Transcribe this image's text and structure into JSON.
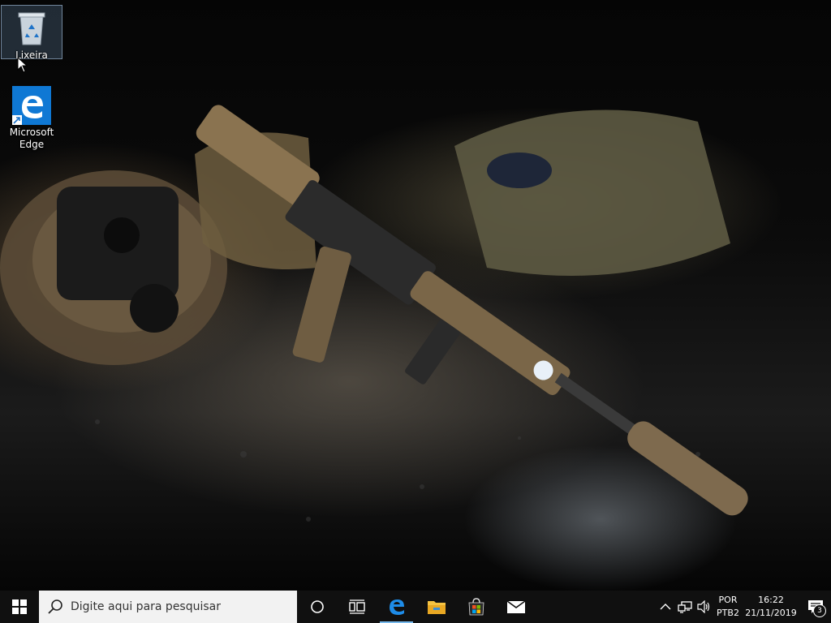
{
  "desktop": {
    "icons": [
      {
        "label": "Lixeira"
      },
      {
        "label": "Microsoft Edge"
      }
    ]
  },
  "taskbar": {
    "search": {
      "placeholder": "Digite aqui para pesquisar"
    },
    "pinned": [
      "cortana-icon",
      "task-view-icon",
      "edge-icon",
      "file-explorer-icon",
      "store-icon",
      "mail-icon"
    ],
    "tray": {
      "language_line1": "POR",
      "language_line2": "PTB2",
      "time": "16:22",
      "date": "21/11/2019",
      "notification_count": "3"
    }
  },
  "colors": {
    "taskbar": "#101010",
    "search_bg": "#f2f2f2",
    "edge_blue": "#0f78d4",
    "active_indicator": "#76b9ed"
  }
}
